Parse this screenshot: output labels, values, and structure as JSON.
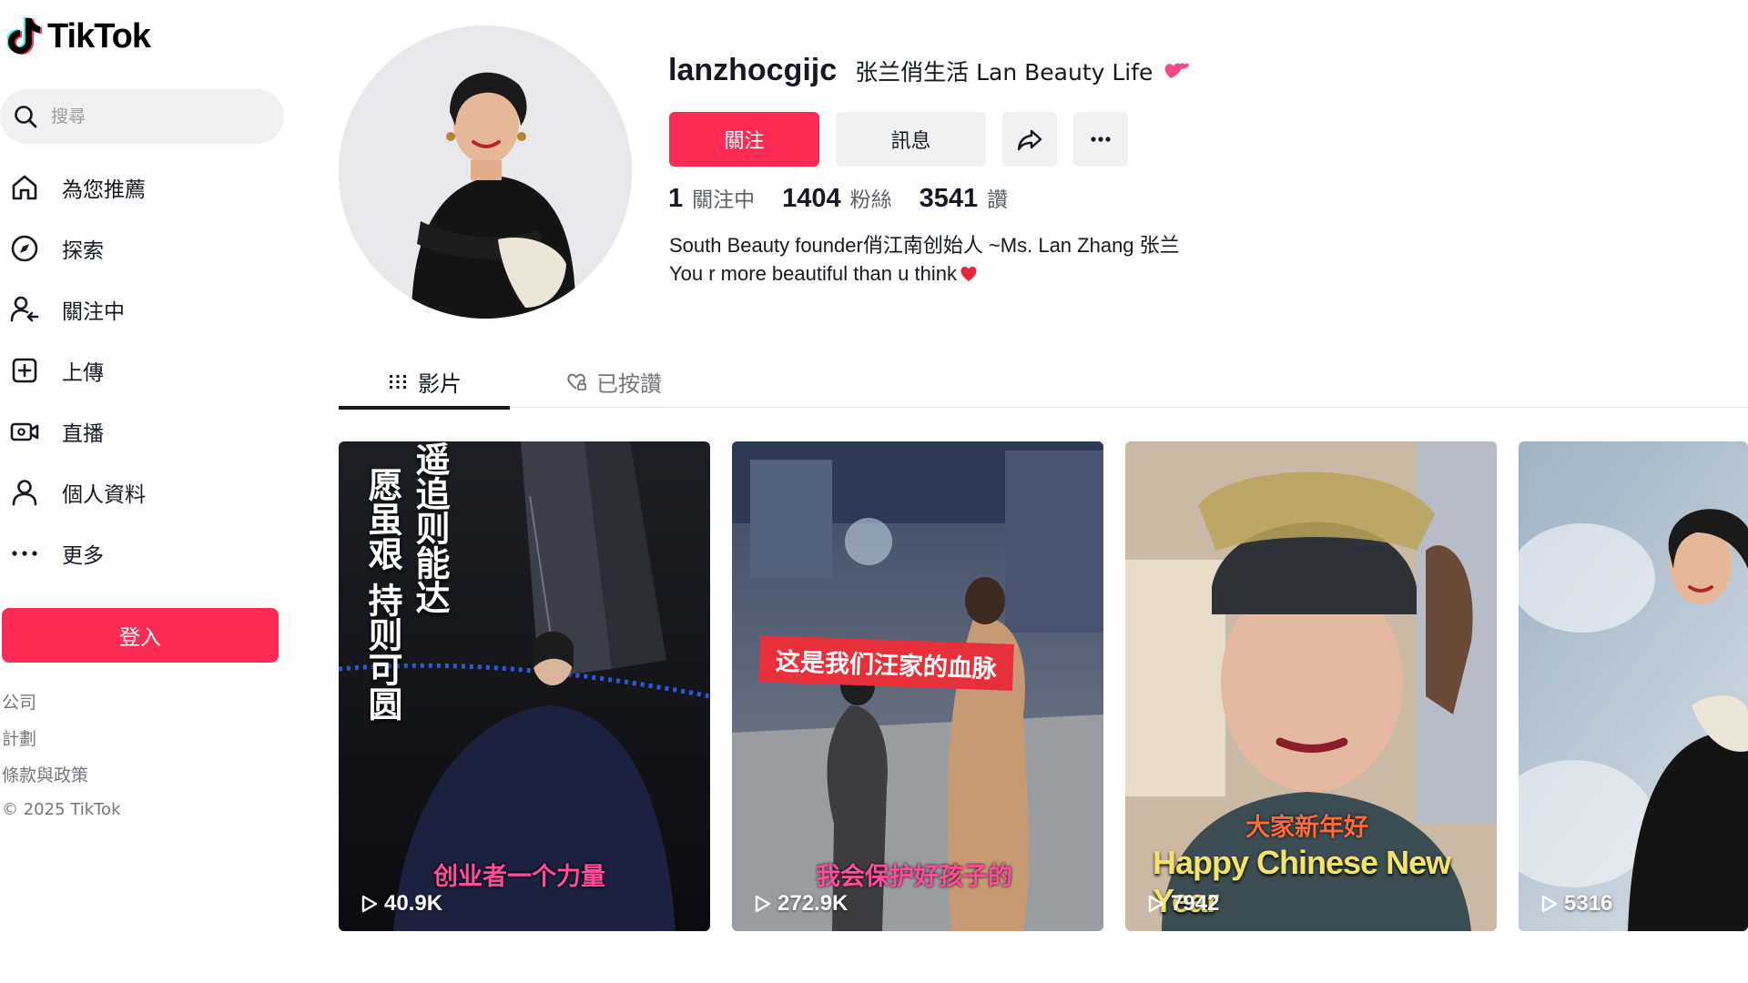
{
  "brand": {
    "name": "TikTok"
  },
  "search": {
    "placeholder": "搜尋"
  },
  "nav": [
    {
      "label": "為您推薦",
      "icon": "home-icon"
    },
    {
      "label": "探索",
      "icon": "compass-icon"
    },
    {
      "label": "關注中",
      "icon": "following-icon"
    },
    {
      "label": "上傳",
      "icon": "upload-icon"
    },
    {
      "label": "直播",
      "icon": "live-icon"
    },
    {
      "label": "個人資料",
      "icon": "profile-icon"
    },
    {
      "label": "更多",
      "icon": "more-icon"
    }
  ],
  "login_label": "登入",
  "footer": {
    "links": [
      "公司",
      "計劃",
      "條款與政策"
    ],
    "copyright": "© 2025 TikTok"
  },
  "profile": {
    "handle": "lanzhocgijc",
    "nickname": "张兰俏生活 Lan Beauty Life",
    "follow_label": "關注",
    "message_label": "訊息",
    "stats": [
      {
        "value": "1",
        "unit": "關注中"
      },
      {
        "value": "1404",
        "unit": "粉絲"
      },
      {
        "value": "3541",
        "unit": "讚"
      }
    ],
    "bio_line1": "South Beauty founder俏江南创始人 ~Ms. Lan Zhang 张兰",
    "bio_line2": "You r more beautiful than u think"
  },
  "tabs": {
    "videos": "影片",
    "liked": "已按讚"
  },
  "videos": [
    {
      "views": "40.9K",
      "caption_vertical": [
        "愿虽艰 持则可圆",
        "遥追则能达"
      ],
      "caption_bottom": "创业者一个力量"
    },
    {
      "views": "272.9K",
      "caption_banner": "这是我们汪家的血脉",
      "caption_bottom": "我会保护好孩子的"
    },
    {
      "views": "7942",
      "caption_top": "大家新年好",
      "caption_bottom": "Happy Chinese New Year"
    },
    {
      "views": "5316"
    }
  ],
  "colors": {
    "accent": "#fe2c55",
    "text": "#161823",
    "muted": "#75767b",
    "surface": "#f1f1f2"
  }
}
